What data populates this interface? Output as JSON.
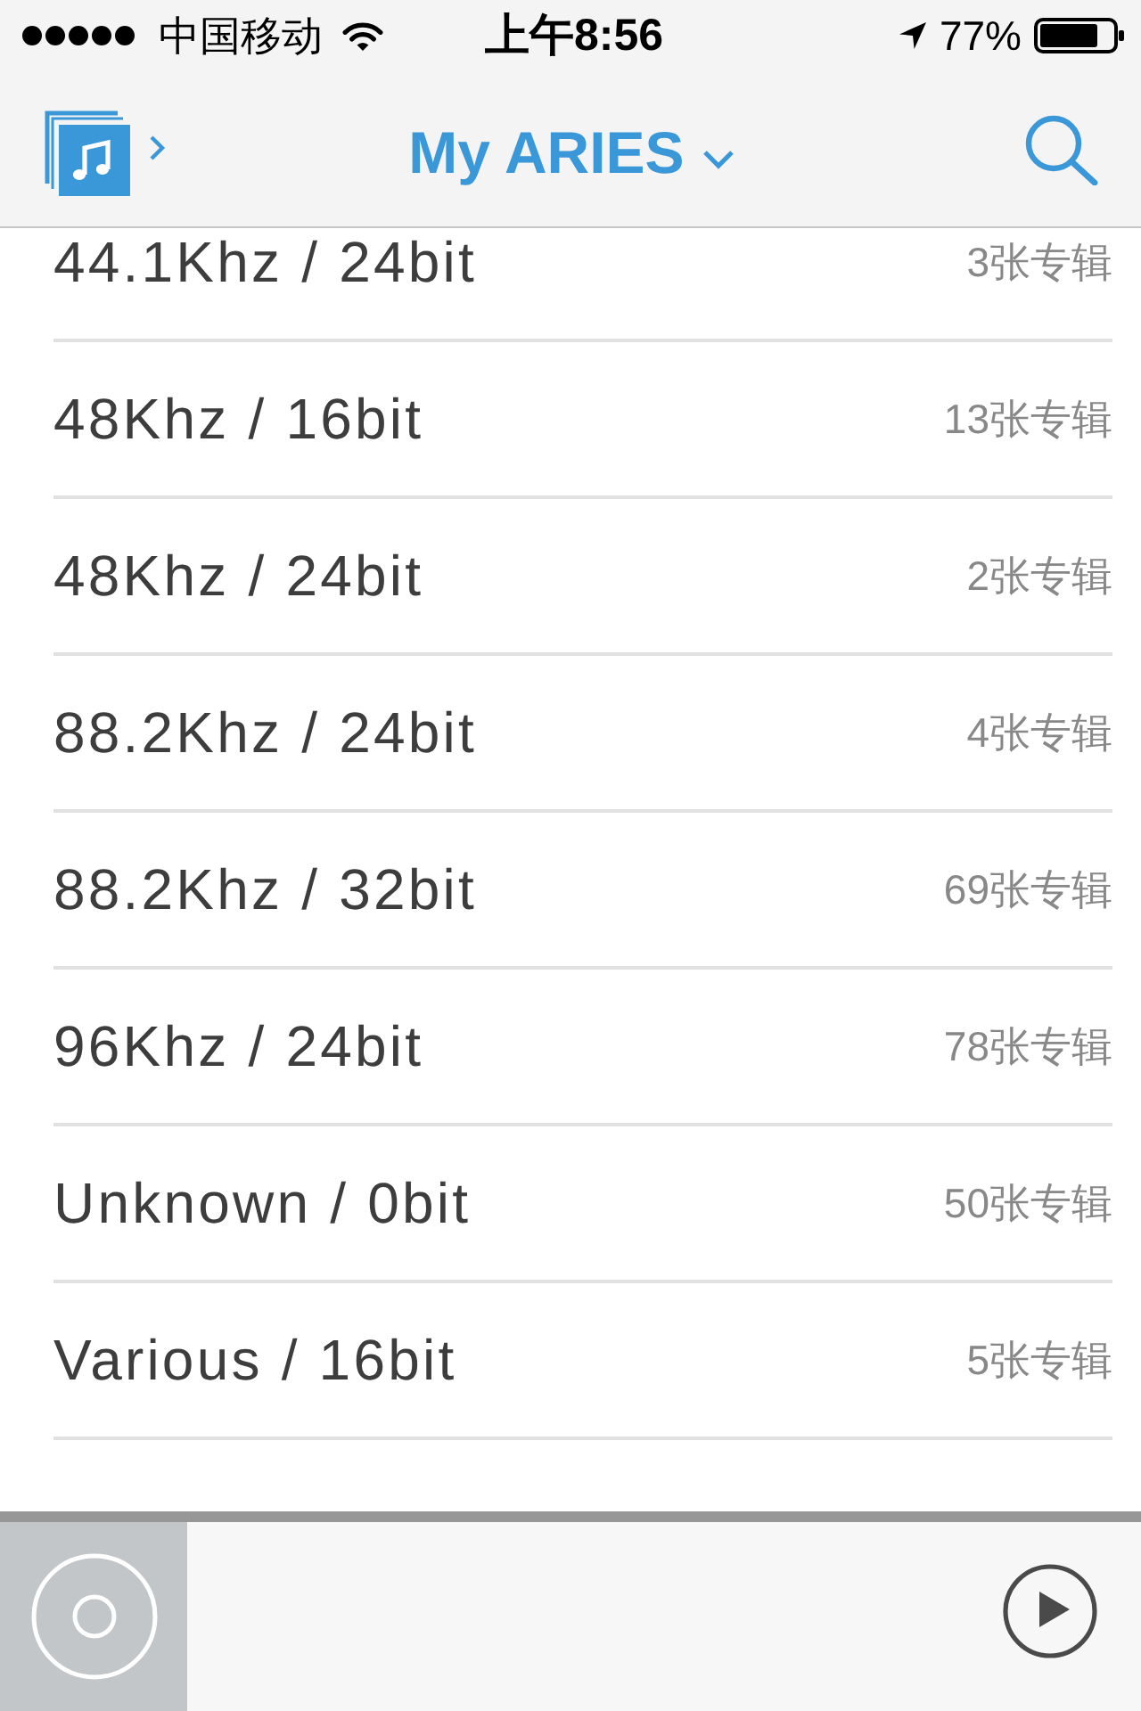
{
  "status_bar": {
    "carrier": "中国移动",
    "time": "上午8:56",
    "battery_percent": "77%"
  },
  "nav_bar": {
    "title": "My ARIES"
  },
  "resolutions": [
    {
      "label": "44.1Khz / 24bit",
      "album_count": "3张专辑"
    },
    {
      "label": "48Khz / 16bit",
      "album_count": "13张专辑"
    },
    {
      "label": "48Khz / 24bit",
      "album_count": "2张专辑"
    },
    {
      "label": "88.2Khz / 24bit",
      "album_count": "4张专辑"
    },
    {
      "label": "88.2Khz / 32bit",
      "album_count": "69张专辑"
    },
    {
      "label": "96Khz / 24bit",
      "album_count": "78张专辑"
    },
    {
      "label": "Unknown / 0bit",
      "album_count": "50张专辑"
    },
    {
      "label": "Various / 16bit",
      "album_count": "5张专辑"
    }
  ]
}
